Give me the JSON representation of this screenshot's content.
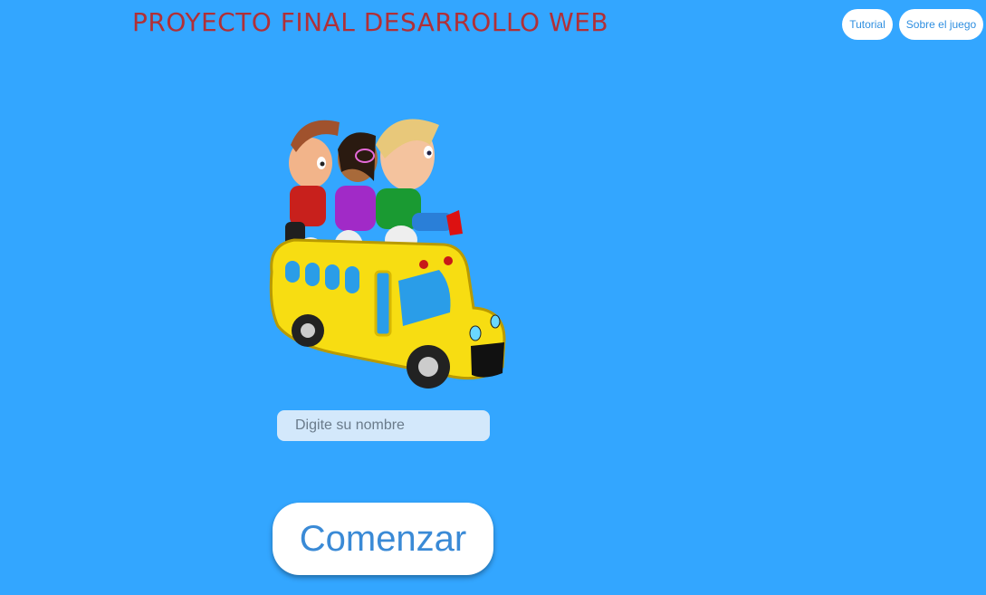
{
  "header": {
    "title": "PROYECTO FINAL DESARROLLO WEB",
    "title_color": "#b03037"
  },
  "nav": {
    "tutorial_label": "Tutorial",
    "about_label": "Sobre el juego"
  },
  "form": {
    "name_placeholder": "Digite su nombre",
    "name_value": "",
    "start_label": "Comenzar"
  },
  "colors": {
    "background": "#33a6ff",
    "button_text": "#3a8ad6"
  },
  "illustration": {
    "icon": "school-bus-kids-illustration"
  }
}
